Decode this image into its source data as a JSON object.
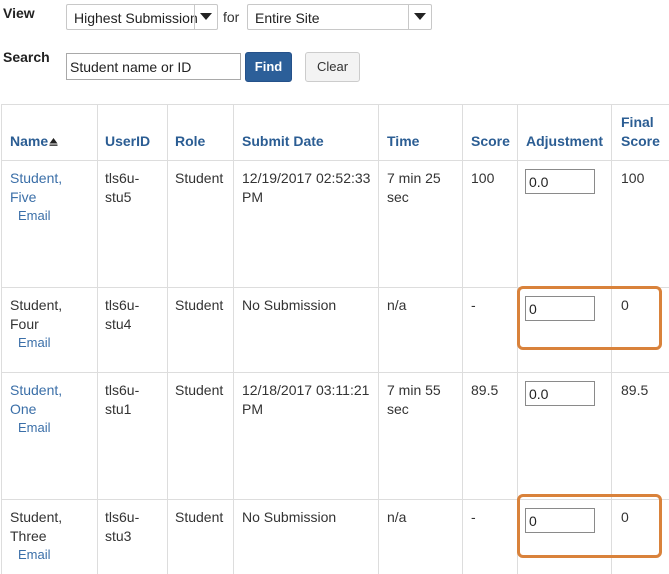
{
  "filters": {
    "view_label": "View",
    "view_value": "Highest Submission",
    "for_label": "for",
    "for_value": "Entire Site",
    "search_label": "Search",
    "search_value": "Student name or ID",
    "find_label": "Find",
    "clear_label": "Clear"
  },
  "table": {
    "headers": {
      "name": "Name",
      "userid": "UserID",
      "role": "Role",
      "submit_date": "Submit Date",
      "time": "Time",
      "score": "Score",
      "adjustment": "Adjustment",
      "final_score_1": "Final",
      "final_score_2": "Score"
    },
    "rows": [
      {
        "name_1": "Student,",
        "name_2": "Five",
        "email": "Email",
        "userid_1": "tls6u-",
        "userid_2": "stu5",
        "role": "Student",
        "date_1": "12/19/2017 02:52:33",
        "date_2": "PM",
        "time_1": "7 min 25",
        "time_2": "sec",
        "score": "100",
        "adjustment": "0.0",
        "final": "100"
      },
      {
        "name_1": "Student,",
        "name_2": "Four",
        "email": "Email",
        "userid_1": "tls6u-",
        "userid_2": "stu4",
        "role": "Student",
        "date_1": "No Submission",
        "date_2": "",
        "time_1": "n/a",
        "time_2": "",
        "score": "-",
        "adjustment": "0",
        "final": "0"
      },
      {
        "name_1": "Student,",
        "name_2": "One",
        "email": "Email",
        "userid_1": "tls6u-",
        "userid_2": "stu1",
        "role": "Student",
        "date_1": "12/18/2017 03:11:21",
        "date_2": "PM",
        "time_1": "7 min 55",
        "time_2": "sec",
        "score": "89.5",
        "adjustment": "0.0",
        "final": "89.5"
      },
      {
        "name_1": "Student,",
        "name_2": "Three",
        "email": "Email",
        "userid_1": "tls6u-",
        "userid_2": "stu3",
        "role": "Student",
        "date_1": "No Submission",
        "date_2": "",
        "time_1": "n/a",
        "time_2": "",
        "score": "-",
        "adjustment": "0",
        "final": "0"
      }
    ]
  }
}
